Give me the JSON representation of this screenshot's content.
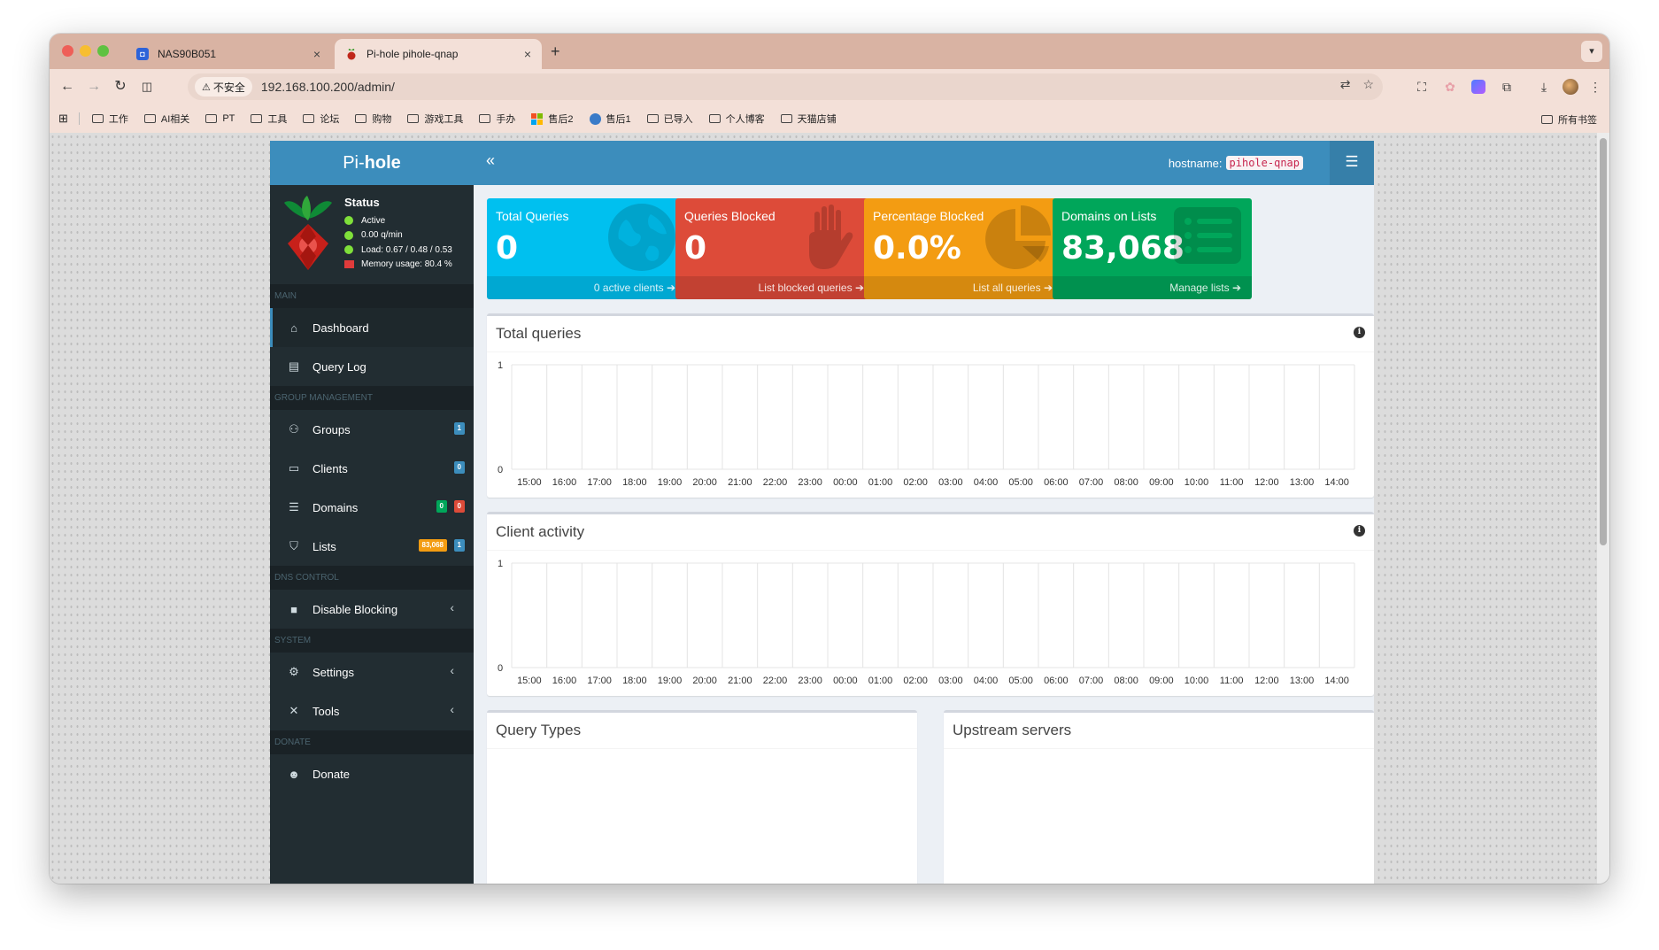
{
  "browser": {
    "tabs": [
      {
        "title": "NAS90B051",
        "close": "×"
      },
      {
        "title": "Pi-hole pihole-qnap",
        "close": "×"
      }
    ],
    "new_tab": "+",
    "security_label": "不安全",
    "url": "192.168.100.200/admin/",
    "bookmarks": [
      "工作",
      "AI相关",
      "PT",
      "工具",
      "论坛",
      "购物",
      "游戏工具",
      "手办",
      "售后2",
      "售后1",
      "已导入",
      "个人博客",
      "天猫店铺"
    ],
    "bookmarks_right": "所有书签"
  },
  "app": {
    "logo_prefix": "Pi-",
    "logo_bold": "hole",
    "status": {
      "title": "Status",
      "active": "Active",
      "rate": "0.00 q/min",
      "load": "Load: 0.67 / 0.48 / 0.53",
      "memory": "Memory usage: 80.4 %"
    },
    "sections": {
      "main": "MAIN",
      "group": "GROUP MANAGEMENT",
      "dns": "DNS CONTROL",
      "system": "SYSTEM",
      "donate": "DONATE"
    },
    "nav": {
      "dashboard": "Dashboard",
      "query_log": "Query Log",
      "groups": "Groups",
      "groups_badge": "1",
      "clients": "Clients",
      "clients_badge": "0",
      "domains": "Domains",
      "domains_badge_allow": "0",
      "domains_badge_deny": "0",
      "lists": "Lists",
      "lists_badge_domains": "83,068",
      "lists_badge_count": "1",
      "disable_blocking": "Disable Blocking",
      "settings": "Settings",
      "tools": "Tools",
      "donate": "Donate"
    },
    "topbar": {
      "hostname_label": "hostname:",
      "hostname_value": "pihole-qnap"
    },
    "cards": [
      {
        "label": "Total Queries",
        "value": "0",
        "footer": "0 active clients",
        "color": "#00c0ef"
      },
      {
        "label": "Queries Blocked",
        "value": "0",
        "footer": "List blocked queries",
        "color": "#dd4b39"
      },
      {
        "label": "Percentage Blocked",
        "value": "0.0%",
        "footer": "List all queries",
        "color": "#f39c12"
      },
      {
        "label": "Domains on Lists",
        "value": "83,068",
        "footer": "Manage lists",
        "color": "#00a65a"
      }
    ],
    "panels": {
      "total_queries": "Total queries",
      "client_activity": "Client activity",
      "query_types": "Query Types",
      "upstream_servers": "Upstream servers"
    }
  },
  "chart_data": [
    {
      "type": "bar",
      "title": "Total queries",
      "categories": [
        "15:00",
        "16:00",
        "17:00",
        "18:00",
        "19:00",
        "20:00",
        "21:00",
        "22:00",
        "23:00",
        "00:00",
        "01:00",
        "02:00",
        "03:00",
        "04:00",
        "05:00",
        "06:00",
        "07:00",
        "08:00",
        "09:00",
        "10:00",
        "11:00",
        "12:00",
        "13:00",
        "14:00"
      ],
      "values": [
        0,
        0,
        0,
        0,
        0,
        0,
        0,
        0,
        0,
        0,
        0,
        0,
        0,
        0,
        0,
        0,
        0,
        0,
        0,
        0,
        0,
        0,
        0,
        0
      ],
      "ylim": [
        0,
        1
      ],
      "yticks": [
        "0",
        "1"
      ],
      "grid": true
    },
    {
      "type": "bar",
      "title": "Client activity",
      "categories": [
        "15:00",
        "16:00",
        "17:00",
        "18:00",
        "19:00",
        "20:00",
        "21:00",
        "22:00",
        "23:00",
        "00:00",
        "01:00",
        "02:00",
        "03:00",
        "04:00",
        "05:00",
        "06:00",
        "07:00",
        "08:00",
        "09:00",
        "10:00",
        "11:00",
        "12:00",
        "13:00",
        "14:00"
      ],
      "values": [
        0,
        0,
        0,
        0,
        0,
        0,
        0,
        0,
        0,
        0,
        0,
        0,
        0,
        0,
        0,
        0,
        0,
        0,
        0,
        0,
        0,
        0,
        0,
        0
      ],
      "ylim": [
        0,
        1
      ],
      "yticks": [
        "0",
        "1"
      ],
      "grid": true
    }
  ]
}
